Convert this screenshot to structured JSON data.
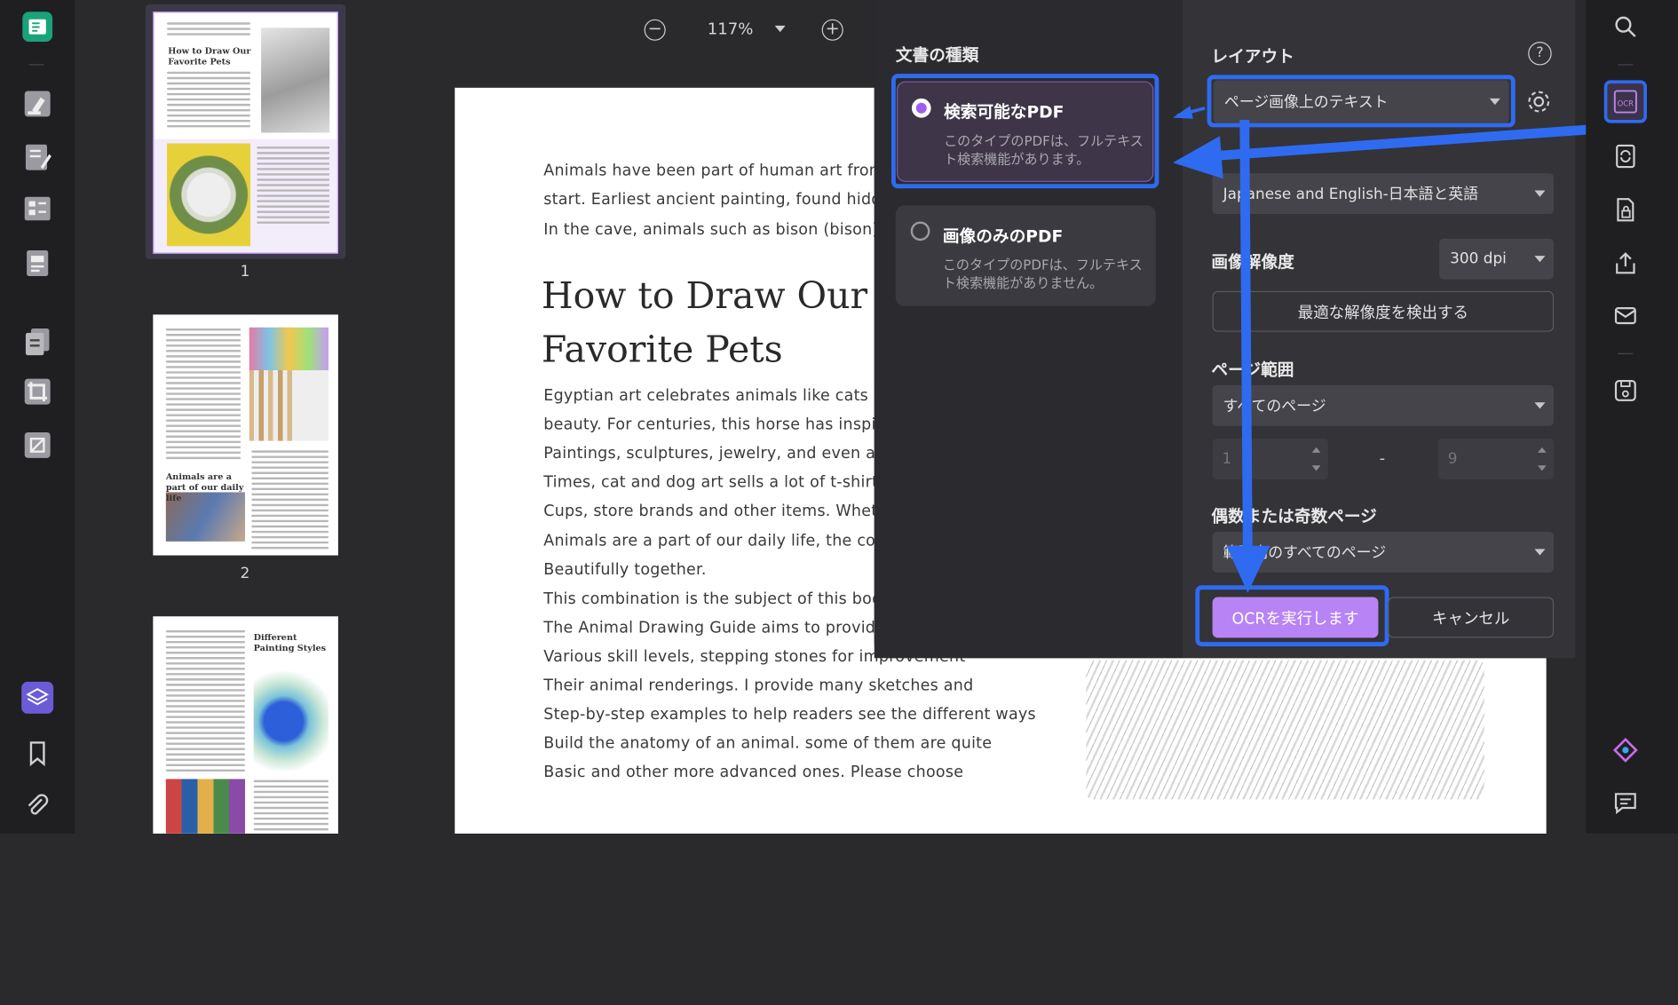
{
  "viewer": {
    "zoom": "117%",
    "thumbnails": [
      {
        "page": "1",
        "heading": "How to Draw Our Favorite Pets"
      },
      {
        "page": "2",
        "heading": "Animals are a part of our daily life"
      },
      {
        "page": "",
        "heading": "Different Painting Styles"
      }
    ]
  },
  "document": {
    "intro_lines": [
      "Animals have been part of human art from the b",
      "start. Earliest ancient painting, found hidden",
      "In the cave, animals such as bison (bison) are fe"
    ],
    "heading_line1": "How to Draw Our",
    "heading_line2": "Favorite Pets",
    "body_lines": [
      "Egyptian art celebrates animals like cats with st",
      "beauty. For centuries, this horse has inspired",
      "Paintings, sculptures, jewelry, and even armor. I",
      "Times, cat and dog art sells a lot of t-shirts, cale",
      "Cups, store brands and other items. Whether it i",
      "Animals are a part of our daily life, the combina",
      "Beautifully together.",
      "This combination is the subject of this book. art",
      "The Animal Drawing Guide aims to provide peop",
      "Various skill levels, stepping stones for improvement",
      "Their animal renderings. I provide many sketches and",
      "Step-by-step examples to help readers see the different ways",
      "Build the anatomy of an animal. some of them are quite",
      "Basic and other more advanced ones. Please choose"
    ]
  },
  "ocr_dialog": {
    "doc_type_label": "文書の種類",
    "option_searchable": {
      "title": "検索可能なPDF",
      "desc": "このタイプのPDFは、フルテキスト検索機能があります。",
      "selected": true
    },
    "option_image_only": {
      "title": "画像のみのPDF",
      "desc": "このタイプのPDFは、フルテキスト検索機能がありません。",
      "selected": false
    },
    "layout_label": "レイアウト",
    "layout_value": "ページ画像上のテキスト",
    "language_value": "Japanese and English-日本語と英語",
    "resolution_label": "画像解像度",
    "resolution_value": "300 dpi",
    "detect_button": "最適な解像度を検出する",
    "page_range_label": "ページ範囲",
    "page_range_value": "すべてのページ",
    "range_from": "1",
    "range_dash": "-",
    "range_to": "9",
    "odd_even_label": "偶数または奇数ページ",
    "odd_even_value": "範囲内のすべてのページ",
    "run_button": "OCRを実行します",
    "cancel_button": "キャンセル"
  },
  "colors": {
    "accent": "#a15ef2",
    "highlight": "#2f6bf0",
    "run_button": "#b783f5"
  },
  "icons": {
    "left_rail": [
      "reader-mode-icon",
      "highlighter-icon",
      "edit-pdf-icon",
      "form-icon",
      "redact-icon",
      "organize-pages-icon",
      "crop-icon",
      "compress-icon",
      "layers-icon",
      "bookmark-icon",
      "attachment-icon"
    ],
    "right_rail": [
      "search-icon",
      "ocr-icon",
      "convert-icon",
      "protect-icon",
      "share-icon",
      "email-icon",
      "save-icon",
      "ai-assistant-icon",
      "comment-icon"
    ]
  }
}
